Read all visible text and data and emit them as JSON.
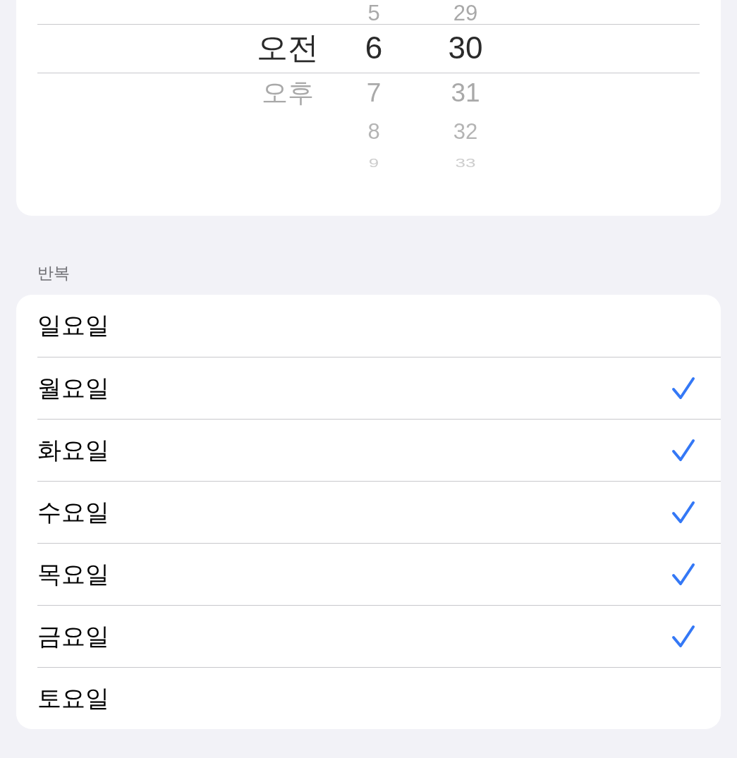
{
  "time_picker": {
    "columns": [
      {
        "items": [
          {
            "label": "오전",
            "selected": true
          },
          {
            "label": "오후",
            "selected": false
          }
        ]
      },
      {
        "items": [
          {
            "label": "5",
            "selected": false
          },
          {
            "label": "6",
            "selected": true
          },
          {
            "label": "7",
            "selected": false
          },
          {
            "label": "8",
            "selected": false
          },
          {
            "label": "9",
            "selected": false
          }
        ]
      },
      {
        "items": [
          {
            "label": "29",
            "selected": false
          },
          {
            "label": "30",
            "selected": true
          },
          {
            "label": "31",
            "selected": false
          },
          {
            "label": "32",
            "selected": false
          },
          {
            "label": "33",
            "selected": false
          }
        ]
      }
    ]
  },
  "repeat_section": {
    "header": "반복",
    "days": [
      {
        "label": "일요일",
        "checked": false
      },
      {
        "label": "월요일",
        "checked": true
      },
      {
        "label": "화요일",
        "checked": true
      },
      {
        "label": "수요일",
        "checked": true
      },
      {
        "label": "목요일",
        "checked": true
      },
      {
        "label": "금요일",
        "checked": true
      },
      {
        "label": "토요일",
        "checked": false
      }
    ]
  }
}
